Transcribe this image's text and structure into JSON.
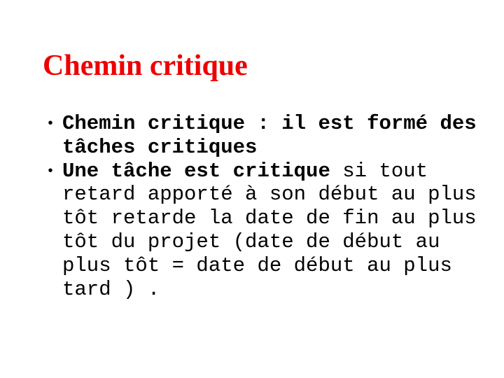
{
  "slide": {
    "title": "Chemin critique",
    "title_color": "#ee0000",
    "bullets": [
      {
        "bullet": "•",
        "lines": [
          {
            "bold": "Chemin critique : il est formé des",
            "normal": ""
          },
          {
            "bold": "tâches critiques",
            "normal": ""
          }
        ]
      },
      {
        "bullet": "•",
        "lines": [
          {
            "bold": "Une tâche est critique",
            "normal": " si tout"
          },
          {
            "bold": "",
            "normal": "retard apporté à son début au plus"
          },
          {
            "bold": "",
            "normal": "tôt retarde la date de fin au plus"
          },
          {
            "bold": "",
            "normal": "tôt du projet (date de début au"
          },
          {
            "bold": "",
            "normal": "plus tôt = date de début au plus"
          },
          {
            "bold": "",
            "normal": "tard ) ."
          }
        ]
      }
    ]
  }
}
